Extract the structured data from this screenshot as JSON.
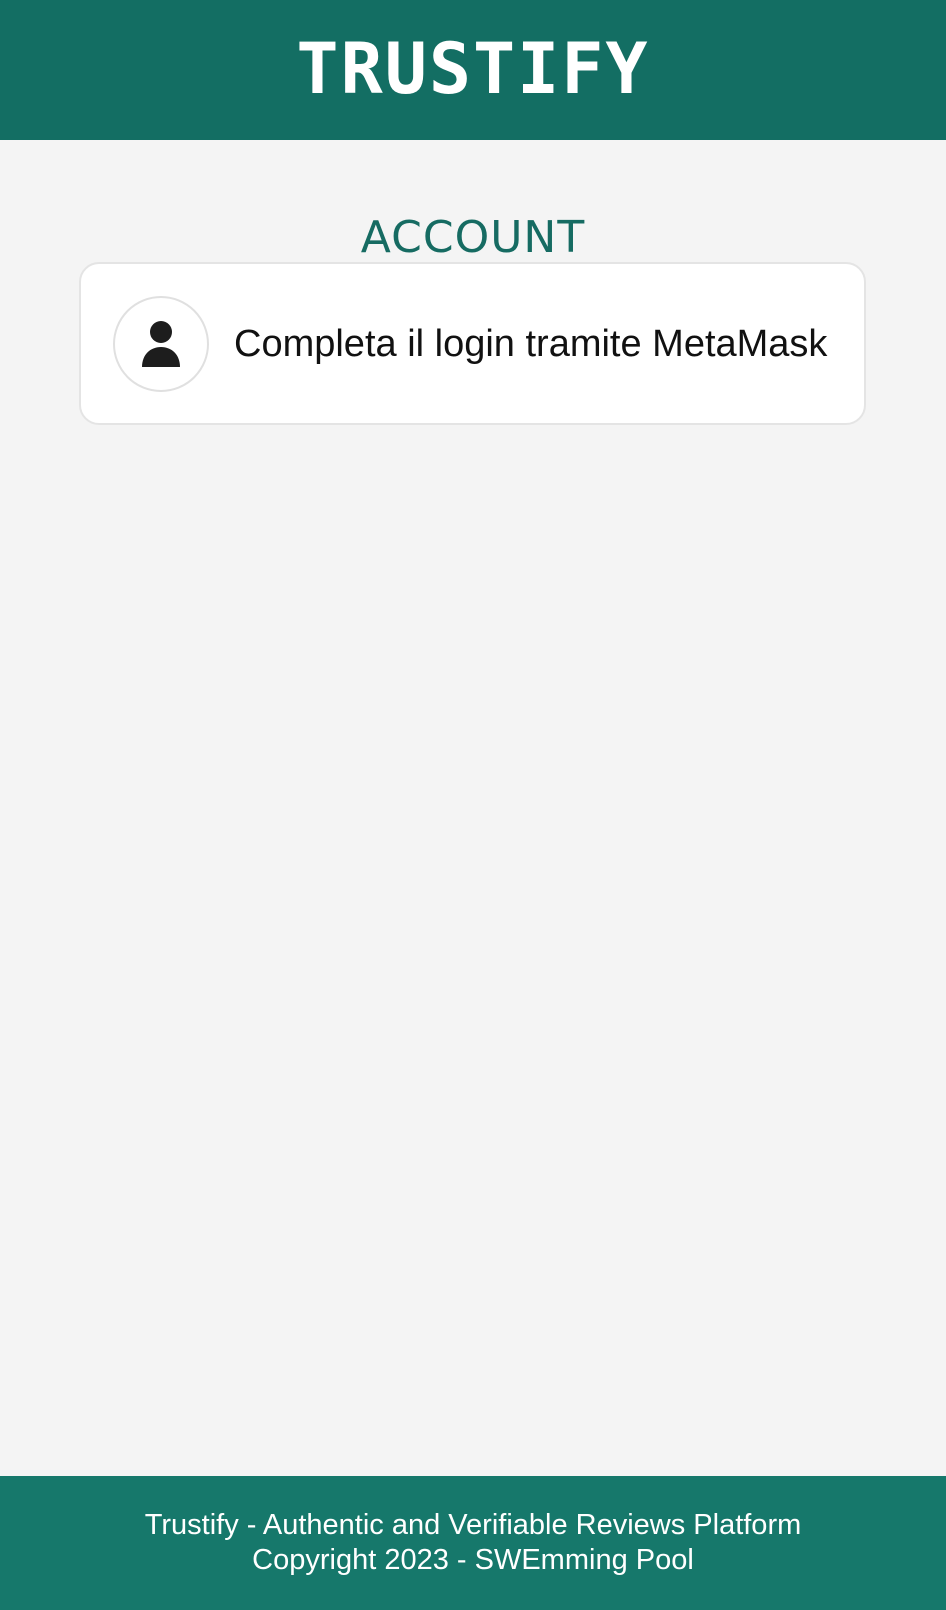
{
  "header": {
    "brand": "TRUSTIFY",
    "background_color": "#136e63"
  },
  "page": {
    "title": "ACCOUNT",
    "title_color": "#166b62",
    "background_color": "#f4f4f4"
  },
  "account_card": {
    "avatar_icon": "user-icon",
    "message": "Completa il login tramite MetaMask"
  },
  "footer": {
    "line_1": "Trustify - Authentic and Verifiable Reviews Platform",
    "line_2": "Copyright 2023 - SWEmming Pool",
    "background_color": "#16786b"
  }
}
